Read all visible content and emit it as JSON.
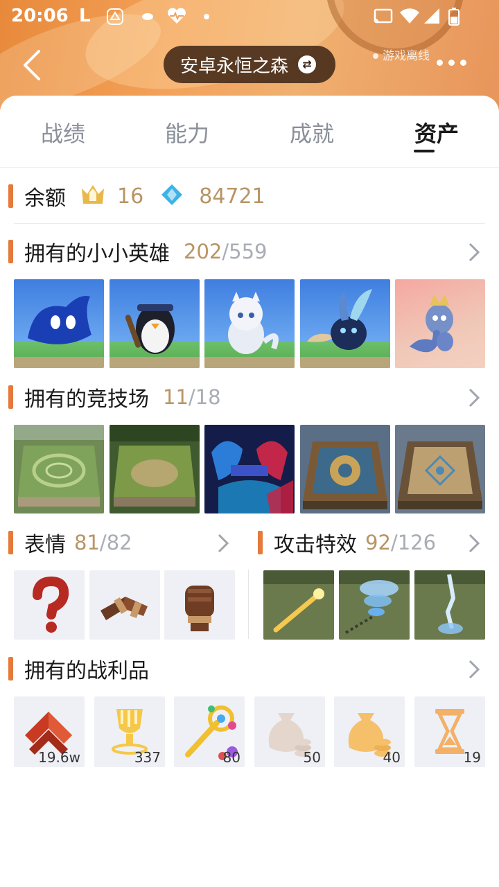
{
  "status_bar": {
    "time": "20:06",
    "carrier_letter": "L"
  },
  "header": {
    "server_name": "安卓永恒之森",
    "status": "游戏离线"
  },
  "tabs": [
    {
      "label": "战绩",
      "active": false
    },
    {
      "label": "能力",
      "active": false
    },
    {
      "label": "成就",
      "active": false
    },
    {
      "label": "资产",
      "active": true
    }
  ],
  "balance": {
    "label": "余额",
    "gold_value": "16",
    "gem_value": "84721"
  },
  "sections": {
    "little_legends": {
      "label": "拥有的小小英雄",
      "owned": "202",
      "total": "559"
    },
    "arenas": {
      "label": "拥有的竞技场",
      "owned": "11",
      "total": "18"
    },
    "emotes": {
      "label": "表情",
      "owned": "81",
      "total": "82"
    },
    "attack_effects": {
      "label": "攻击特效",
      "owned": "92",
      "total": "126"
    },
    "loot": {
      "label": "拥有的战利品"
    }
  },
  "loot_items": [
    {
      "icon": "rank-chevron-icon",
      "qty": "19.6w"
    },
    {
      "icon": "trophy-icon",
      "qty": "337"
    },
    {
      "icon": "scepter-icon",
      "qty": "80"
    },
    {
      "icon": "money-bag-grey-icon",
      "qty": "50"
    },
    {
      "icon": "money-bag-gold-icon",
      "qty": "40"
    },
    {
      "icon": "hourglass-icon",
      "qty": "19"
    }
  ],
  "colors": {
    "accent": "#e57a3a",
    "owned": "#b89465",
    "total": "#a8adb5"
  }
}
